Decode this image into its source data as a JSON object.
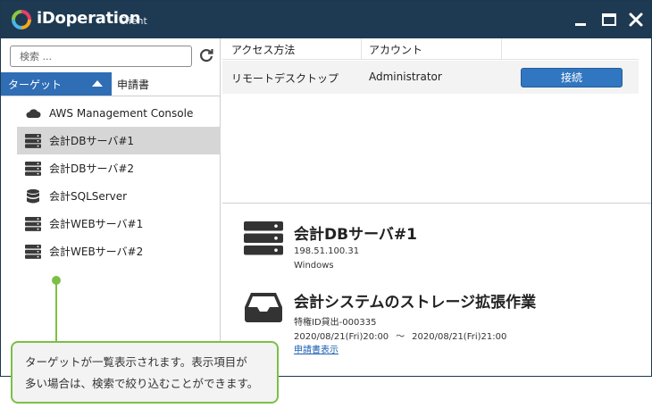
{
  "titlebar": {
    "brand": "iDoperation",
    "brand_sub": "Client"
  },
  "sidebar": {
    "search_placeholder": "検索 ...",
    "tab_target": "ターゲット",
    "tab_request": "申請書",
    "items": [
      {
        "label": "AWS Management Console",
        "icon": "cloud-icon"
      },
      {
        "label": "会計DBサーバ#1",
        "icon": "server-icon",
        "selected": true
      },
      {
        "label": "会計DBサーバ#2",
        "icon": "server-icon"
      },
      {
        "label": "会計SQLServer",
        "icon": "database-icon"
      },
      {
        "label": "会計WEBサーバ#1",
        "icon": "server-icon"
      },
      {
        "label": "会計WEBサーバ#2",
        "icon": "server-icon"
      }
    ]
  },
  "grid": {
    "columns": [
      "アクセス方法",
      "アカウント",
      ""
    ],
    "rows": [
      {
        "method": "リモートデスクトップ",
        "account": "Administrator",
        "action": "接続"
      }
    ]
  },
  "detail": {
    "target_name": "会計DBサーバ#1",
    "ip": "198.51.100.31",
    "os": "Windows",
    "request_title": "会計システムのストレージ拡張作業",
    "request_id": "特権ID貸出-000335",
    "period_start": "2020/08/21(Fri)20:00",
    "period_sep": "～",
    "period_end": "2020/08/21(Fri)21:00",
    "link": "申請書表示"
  },
  "callout": {
    "line1": "ターゲットが一覧表示されます。表示項目が",
    "line2": "多い場合は、検索で絞り込むことができます。"
  },
  "colors": {
    "titlebar": "#1e3a52",
    "accent": "#2f6db5",
    "callout_border": "#7cbf47"
  }
}
